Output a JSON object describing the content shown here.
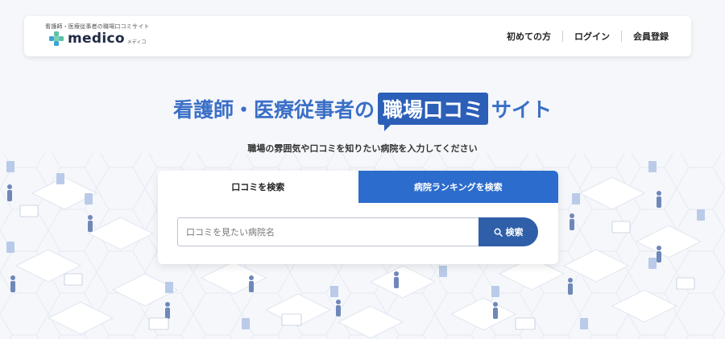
{
  "header": {
    "tagline": "看護師・医療従事者の職場口コミサイト",
    "logo_text": "medico",
    "logo_kana": "メディコ",
    "nav": [
      {
        "label": "初めての方"
      },
      {
        "label": "ログイン"
      },
      {
        "label": "会員登録"
      }
    ]
  },
  "hero": {
    "title_before": "看護師・医療従事者の",
    "title_highlight": "職場口コミ",
    "title_after": "サイト",
    "subtitle": "職場の雰囲気や口コミを知りたい病院を入力してください"
  },
  "search": {
    "tabs": [
      {
        "label": "口コミを検索",
        "active": true
      },
      {
        "label": "病院ランキングを検索",
        "active": false
      }
    ],
    "placeholder": "口コミを見たい病院名",
    "value": "",
    "button_label": "検索"
  },
  "colors": {
    "brand_blue": "#2c6ccd",
    "title_blue": "#3b6fc7",
    "logo_green": "#5cc2a6",
    "button_blue": "#2f5fa8"
  }
}
